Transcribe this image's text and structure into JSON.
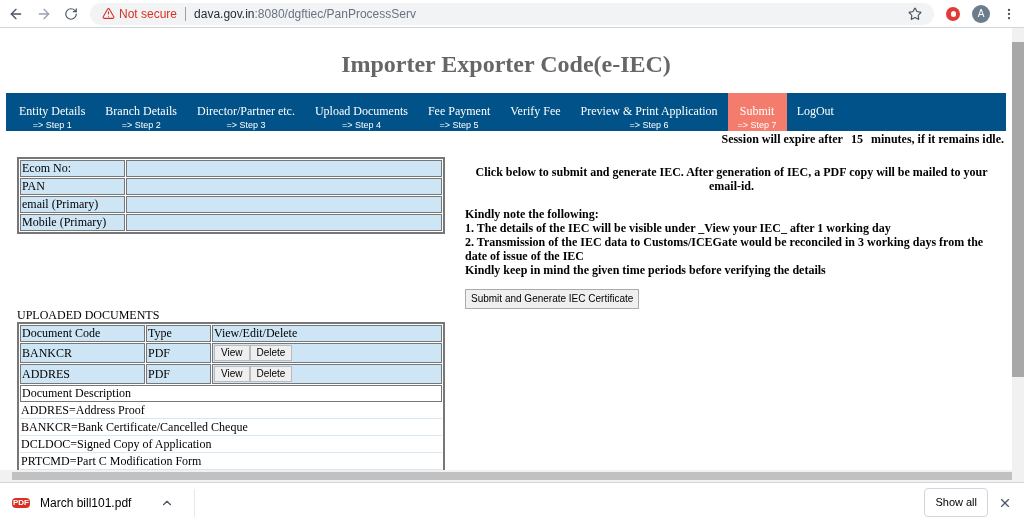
{
  "browser": {
    "security": "Not secure",
    "url_host": "dava.gov.in",
    "url_rest": ":8080/dgftiec/PanProcessServ",
    "avatar": "A"
  },
  "title": "Importer Exporter Code(e-IEC)",
  "nav": [
    {
      "label": "Entity Details",
      "step": "=> Step 1",
      "selected": false
    },
    {
      "label": "Branch Details",
      "step": "=> Step 2",
      "selected": false
    },
    {
      "label": "Director/Partner etc.",
      "step": "=> Step 3",
      "selected": false
    },
    {
      "label": "Upload Documents",
      "step": "=> Step 4",
      "selected": false
    },
    {
      "label": "Fee Payment",
      "step": "=> Step 5",
      "selected": false
    },
    {
      "label": "Verify Fee",
      "selected": false
    },
    {
      "label": "Preview & Print Application",
      "step": "=> Step 6",
      "selected": false
    },
    {
      "label": "Submit",
      "step": "=> Step 7",
      "selected": true
    },
    {
      "label": "LogOut",
      "selected": false
    }
  ],
  "session": {
    "before": "Session will expire after",
    "minutes": "15",
    "after": "minutes, if it remains idle."
  },
  "profile": [
    "Ecom No:",
    "PAN",
    "email (Primary)",
    "Mobile (Primary)"
  ],
  "documents": {
    "heading": "UPLOADED DOCUMENTS",
    "columns": [
      "Document Code",
      "Type",
      "View/Edit/Delete"
    ],
    "rows": [
      {
        "code": "BANKCR",
        "type": "PDF",
        "view": "View",
        "delete": "Delete"
      },
      {
        "code": "ADDRES",
        "type": "PDF",
        "view": "View",
        "delete": "Delete"
      }
    ],
    "description_heading": "Document Description",
    "descriptions": [
      "ADDRES=Address Proof",
      "BANKCR=Bank Certificate/Cancelled Cheque",
      "DCLDOC=Signed Copy of Application",
      "PRTCMD=Part C Modification Form"
    ]
  },
  "submit": {
    "intro": "Click below to submit and generate IEC. After generation of IEC, a PDF copy will be mailed to your email-id.",
    "notes": [
      "Kindly note the following:",
      "1. The details of the IEC will be visible under _View your IEC_ after 1 working day",
      "2. Transmission of the IEC data to Customs/ICEGate would be reconciled in 3 working days from the date of issue of the IEC",
      "Kindly keep in mind the given time periods before verifying the details"
    ],
    "button": "Submit and Generate IEC Certificate"
  },
  "downloads": {
    "file": "March bill101.pdf",
    "file_badge": "PDF",
    "show_all": "Show all"
  }
}
